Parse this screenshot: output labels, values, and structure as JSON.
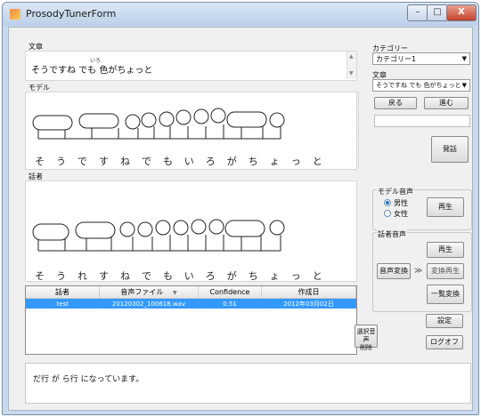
{
  "window": {
    "title": "ProsodyTunerForm",
    "min": "–",
    "max": "□",
    "close": "X"
  },
  "sentence": {
    "label": "文章",
    "ruby": "いろ",
    "text": "そうですね でも 色がちょっと"
  },
  "model": {
    "label": "モデル",
    "kana": "そうですねでもいろがちょっと"
  },
  "speaker": {
    "label": "話者",
    "kana": "そうれすねでもいろがちょっと"
  },
  "table": {
    "headers": [
      "話者",
      "音声ファイル",
      "Confidence",
      "作成日"
    ],
    "sort_icon": "chevron-down-icon",
    "rows": [
      [
        "test",
        "20120302_100618.wav",
        "0.51",
        "2012年03月02日"
      ]
    ]
  },
  "message": "だ行 が ら行 になっています。",
  "right": {
    "category_label": "カテゴリー",
    "category_value": "カテゴリー1",
    "sentence_label": "文章",
    "sentence_value": "そうですね でも 色がちょっと",
    "back": "戻る",
    "next": "進む",
    "speak": "発話",
    "model_voice_label": "モデル音声",
    "male": "男性",
    "female": "女性",
    "play1": "再生",
    "speaker_voice_label": "話者音声",
    "play2": "再生",
    "voice_convert": "音声変換",
    "chevron": "≫",
    "convert_play": "変換再生",
    "batch_convert": "一覧変換",
    "delete_selected": "選択音声\n削除",
    "settings": "設定",
    "logoff": "ログオフ"
  },
  "colors": {
    "selection": "#3399ff",
    "accent": "#1d6fc8"
  }
}
